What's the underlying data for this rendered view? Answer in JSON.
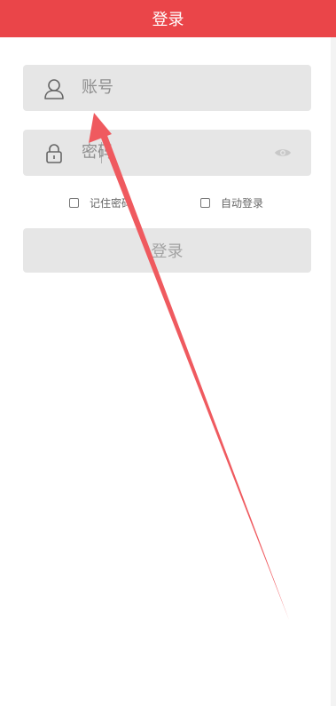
{
  "header": {
    "title": "登录"
  },
  "username": {
    "placeholder": "账号",
    "icon": "user-icon"
  },
  "password": {
    "placeholder": "密码",
    "icon": "lock-icon",
    "toggle_icon": "eye-icon"
  },
  "options": {
    "remember_label": "记住密码",
    "auto_login_label": "自动登录"
  },
  "login_button": {
    "label": "登录"
  },
  "colors": {
    "header_bg": "#ea4549",
    "field_bg": "#e6e6e6",
    "placeholder": "#8f8f8f",
    "arrow": "#ef5a5f"
  }
}
